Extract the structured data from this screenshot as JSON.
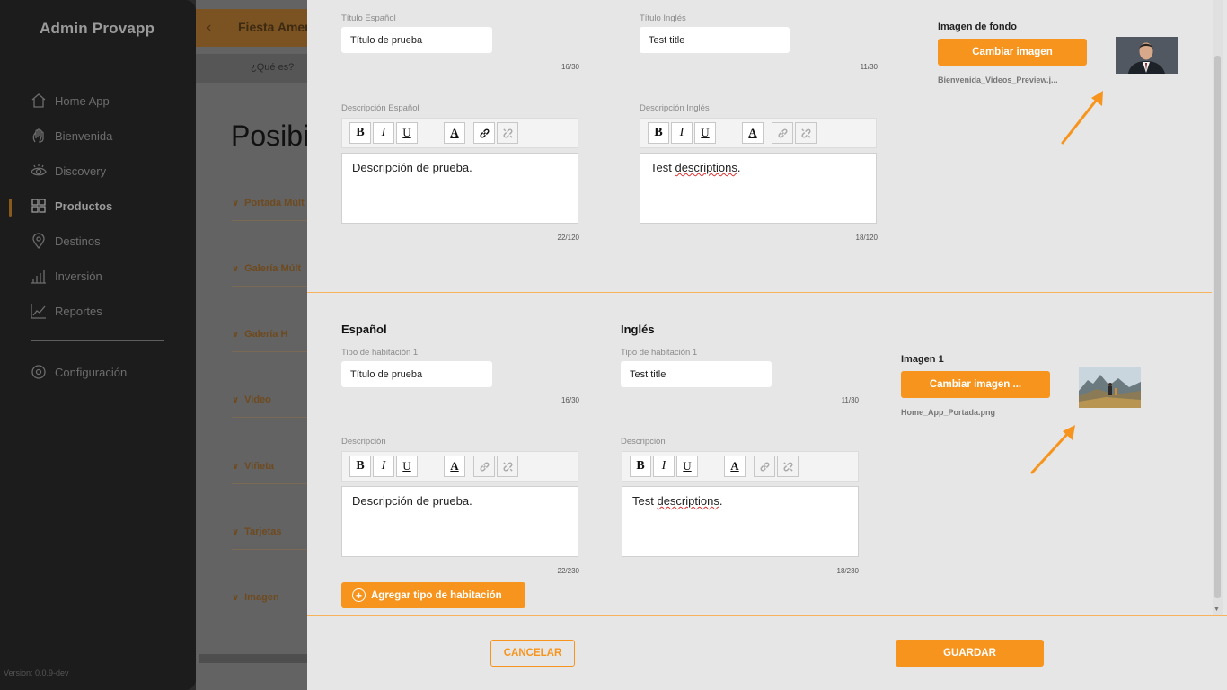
{
  "sidebar": {
    "brand": "Admin Provapp",
    "items": [
      {
        "label": "Home App",
        "icon": "home-icon"
      },
      {
        "label": "Bienvenida",
        "icon": "hand-icon"
      },
      {
        "label": "Discovery",
        "icon": "eye-icon"
      },
      {
        "label": "Productos",
        "icon": "grid-icon",
        "active": true
      },
      {
        "label": "Destinos",
        "icon": "location-pin-icon"
      },
      {
        "label": "Inversión",
        "icon": "bar-chart-icon"
      },
      {
        "label": "Reportes",
        "icon": "line-chart-icon"
      },
      {
        "label": "Configuración",
        "icon": "gear-icon"
      }
    ],
    "version": "Version: 0.0.9-dev"
  },
  "background_page": {
    "back_icon": "chevron-left-icon",
    "title": "Fiesta Ameri",
    "subtab": "¿Qué es?",
    "heading": "Posibi",
    "sections": [
      "Portada Múlt",
      "Galería Múlt",
      "Galería H",
      "Video",
      "Viñeta",
      "Tarjetas",
      "Imagen"
    ]
  },
  "modal": {
    "top": {
      "title_es_label": "Título Español",
      "title_es_value": "Título de prueba",
      "title_es_counter": "16/30",
      "title_en_label": "Título Inglés",
      "title_en_value": "Test title",
      "title_en_counter": "11/30",
      "desc_es_label": "Descripción Español",
      "desc_es_value": "Descripción de prueba.",
      "desc_es_counter": "22/120",
      "desc_en_label": "Descripción Inglés",
      "desc_en_value_plain": "Test ",
      "desc_en_value_misspelled": "descriptions",
      "desc_en_value_end": ".",
      "desc_en_counter": "18/120",
      "image_label": "Imagen de fondo",
      "change_image_button": "Cambiar imagen",
      "image_filename": "Bienvenida_Videos_Preview.j..."
    },
    "room": {
      "spanish_title": "Español",
      "english_title": "Inglés",
      "type_es_label": "Tipo de habitación 1",
      "type_es_value": "Título de prueba",
      "type_es_counter": "16/30",
      "type_en_label": "Tipo de habitación 1",
      "type_en_value": "Test title",
      "type_en_counter": "11/30",
      "desc_es_label": "Descripción",
      "desc_es_value": "Descripción de prueba.",
      "desc_es_counter": "22/230",
      "desc_en_label": "Descripción",
      "desc_en_value_plain": "Test ",
      "desc_en_value_misspelled": "descriptions",
      "desc_en_value_end": ".",
      "desc_en_counter": "18/230",
      "image_label": "Imagen 1",
      "change_image_button": "Cambiar imagen ...",
      "image_filename": "Home_App_Portada.png",
      "add_room_button": "Agregar tipo de habitación",
      "add_icon": "plus-circle-icon"
    },
    "toolbar": {
      "bold": "B",
      "italic": "I",
      "underline": "U",
      "font_color": "A",
      "link_icon": "link-icon",
      "unlink_icon": "unlink-icon"
    },
    "footer": {
      "cancel": "CANCELAR",
      "save": "GUARDAR"
    },
    "accent_color": "#f7941d"
  }
}
